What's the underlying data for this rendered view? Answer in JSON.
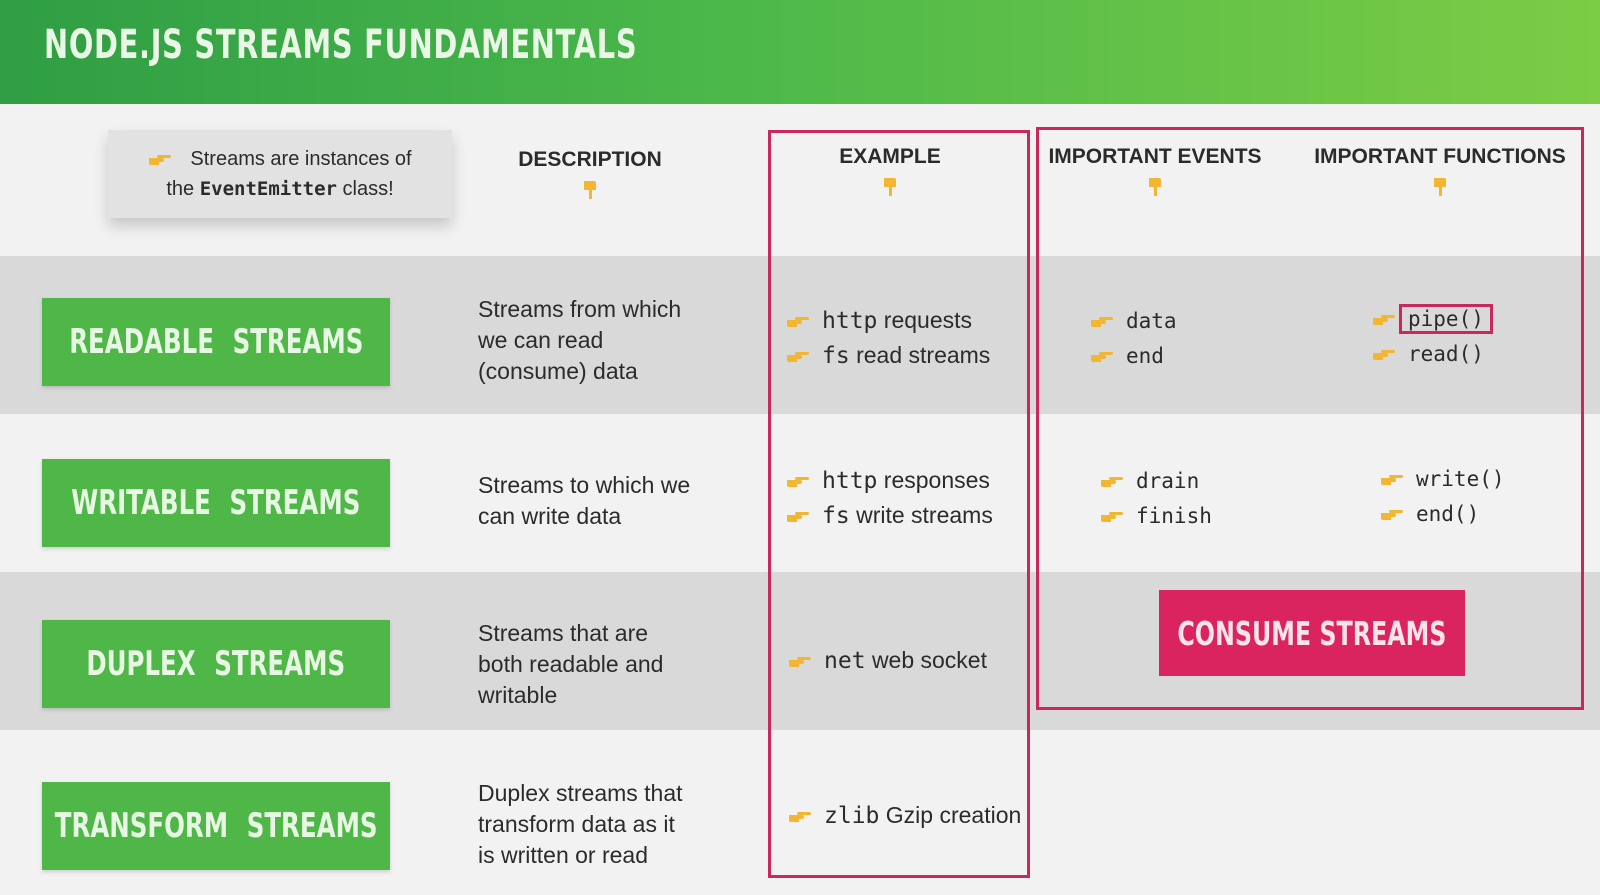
{
  "title": "NODE.JS STREAMS FUNDAMENTALS",
  "note": {
    "prefix": "Streams are instances of",
    "the": "the",
    "code": "EventEmitter",
    "suffix": "class!"
  },
  "columns": {
    "description": "DESCRIPTION",
    "example": "EXAMPLE",
    "events": "IMPORTANT EVENTS",
    "functions": "IMPORTANT FUNCTIONS"
  },
  "rows": [
    {
      "label": "READABLE STREAMS",
      "description": [
        "Streams from which",
        "we can read",
        "(consume) data"
      ],
      "examples": [
        {
          "code": "http",
          "text": "requests"
        },
        {
          "code": "fs",
          "text": "read streams"
        }
      ],
      "events": [
        "data",
        "end"
      ],
      "functions": [
        "pipe()",
        "read()"
      ]
    },
    {
      "label": "WRITABLE STREAMS",
      "description": [
        "Streams to which we",
        "can write data"
      ],
      "examples": [
        {
          "code": "http",
          "text": "responses"
        },
        {
          "code": "fs",
          "text": "write streams"
        }
      ],
      "events": [
        "drain",
        "finish"
      ],
      "functions": [
        "write()",
        "end()"
      ]
    },
    {
      "label": "DUPLEX STREAMS",
      "description": [
        "Streams that are",
        "both readable and",
        "writable"
      ],
      "examples": [
        {
          "code": "net",
          "text": "web socket"
        }
      ]
    },
    {
      "label": "TRANSFORM STREAMS",
      "description": [
        "Duplex streams that",
        "transform data as it",
        "is written or read"
      ],
      "examples": [
        {
          "code": "zlib",
          "text": "Gzip creation"
        }
      ]
    }
  ],
  "consume_button": "CONSUME STREAMS",
  "colors": {
    "green": "#4fb748",
    "accent": "#c8285d",
    "pink": "#d9245f",
    "hand": "#f2b632"
  },
  "icons": [
    "pointing-right-hand-icon",
    "pointing-down-hand-icon"
  ]
}
